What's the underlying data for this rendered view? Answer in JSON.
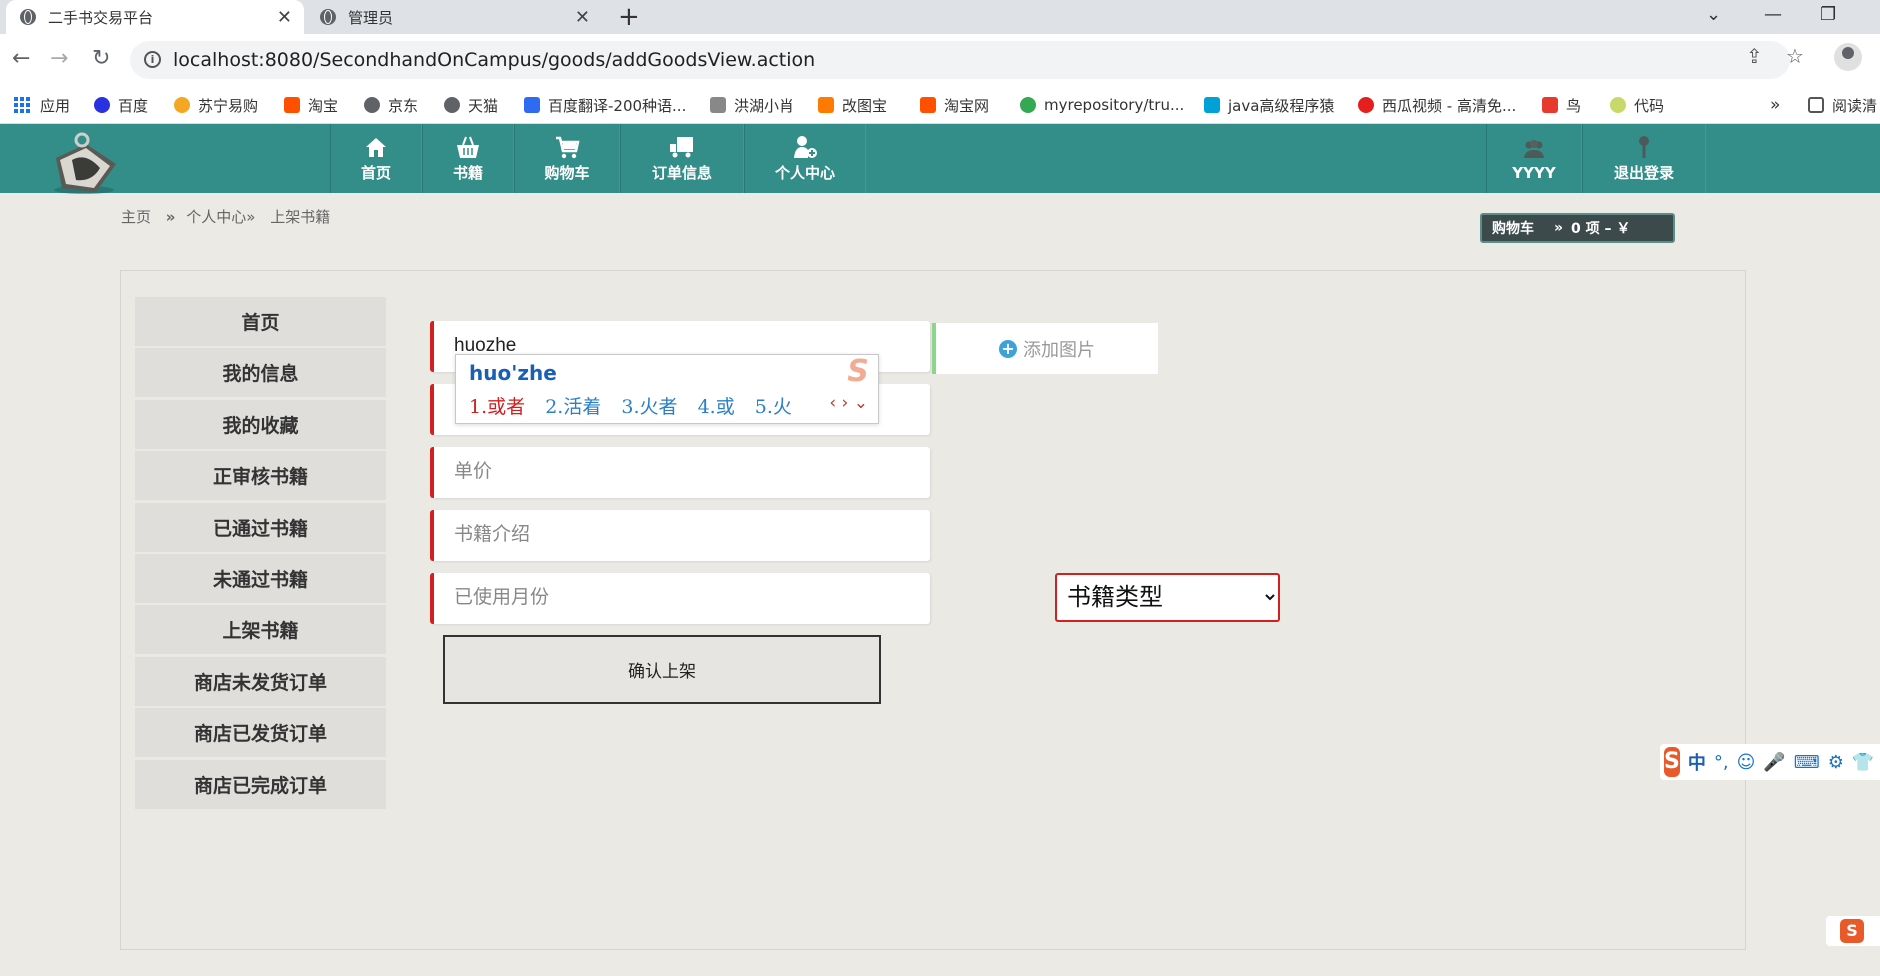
{
  "browser": {
    "tabs": [
      {
        "title": "二手书交易平台",
        "active": true
      },
      {
        "title": "管理员",
        "active": false
      }
    ],
    "url": "localhost:8080/SecondhandOnCampus/goods/addGoodsView.action",
    "bookmarks": [
      {
        "label": "应用",
        "icon": "apps-grid-icon"
      },
      {
        "label": "百度",
        "icon": "baidu-paw-icon",
        "color": "#2932e1"
      },
      {
        "label": "苏宁易购",
        "icon": "suning-icon",
        "color": "#f5a623"
      },
      {
        "label": "淘宝",
        "icon": "taobao-icon",
        "color": "#ff5000"
      },
      {
        "label": "京东",
        "icon": "globe-icon",
        "color": "#5f6368"
      },
      {
        "label": "天猫",
        "icon": "globe-icon",
        "color": "#5f6368"
      },
      {
        "label": "百度翻译-200种语...",
        "icon": "baidu-translate-icon",
        "color": "#2f6bf2"
      },
      {
        "label": "洪湖小肖",
        "icon": "feather-icon",
        "color": "#888888"
      },
      {
        "label": "改图宝",
        "icon": "gaitubao-icon",
        "color": "#ff7a00"
      },
      {
        "label": "淘宝网",
        "icon": "taobao-icon",
        "color": "#ff5000"
      },
      {
        "label": "myrepository/tru...",
        "icon": "chrome-icon",
        "color": "#34a853"
      },
      {
        "label": "java高级程序猿",
        "icon": "bilibili-icon",
        "color": "#00a1d6"
      },
      {
        "label": "西瓜视频 - 高清免...",
        "icon": "xigua-icon",
        "color": "#e61e1e"
      },
      {
        "label": "鸟",
        "icon": "bird-icon",
        "color": "#e63a2e"
      },
      {
        "label": "代码",
        "icon": "leaf-icon",
        "color": "#c9d86a"
      }
    ],
    "bookmarks_overflow": "»",
    "reading_list": "阅读清"
  },
  "header": {
    "nav": [
      {
        "label": "首页",
        "icon": "home-icon"
      },
      {
        "label": "书籍",
        "icon": "basket-icon"
      },
      {
        "label": "购物车",
        "icon": "cart-icon"
      },
      {
        "label": "订单信息",
        "icon": "truck-icon"
      },
      {
        "label": "个人中心",
        "icon": "user-add-icon"
      }
    ],
    "user": {
      "label": "YYYY",
      "icon": "users-icon"
    },
    "logout": {
      "label": "退出登录",
      "icon": "pin-icon"
    },
    "color": "#338d89"
  },
  "breadcrumb": {
    "home": "主页",
    "sep1": "»",
    "center": "个人中心»",
    "current": "上架书籍"
  },
  "cart_summary": {
    "label": "购物车",
    "arrow": "»",
    "text": "0 项 – ￥"
  },
  "sidebar": {
    "items": [
      "首页",
      "我的信息",
      "我的收藏",
      "正审核书籍",
      "已通过书籍",
      "未通过书籍",
      "上架书籍",
      "商店未发货订单",
      "商店已发货订单",
      "商店已完成订单"
    ]
  },
  "form": {
    "name_value": "huozhe",
    "add_image_label": "添加图片",
    "price_placeholder": "单价",
    "intro_placeholder": "书籍介绍",
    "months_placeholder": "已使用月份",
    "type_selected": "书籍类型",
    "submit_label": "确认上架"
  },
  "ime": {
    "composition": "huo'zhe",
    "candidates": [
      "1.或者",
      "2.活着",
      "3.火者",
      "4.或",
      "5.火"
    ],
    "bar_mode": "中",
    "bar_punct": "°,",
    "accent": "#e85a2a"
  }
}
